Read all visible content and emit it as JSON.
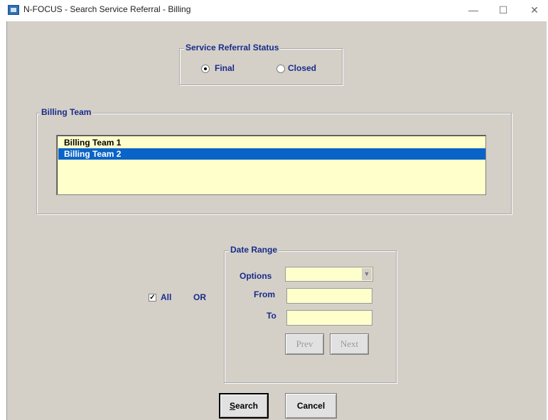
{
  "window": {
    "title": "N-FOCUS - Search Service Referral - Billing",
    "minimize": "—",
    "maximize": "☐",
    "close": "✕"
  },
  "status_group": {
    "legend": "Service Referral Status",
    "options": [
      {
        "label": "Final",
        "selected": true
      },
      {
        "label": "Closed",
        "selected": false
      }
    ]
  },
  "billing_group": {
    "legend": "Billing Team",
    "items": [
      "Billing Team 1",
      "Billing Team 2"
    ],
    "selected_index": 1
  },
  "all_checkbox": {
    "label": "All",
    "checked": true
  },
  "or_label": "OR",
  "date_group": {
    "legend": "Date Range",
    "options_label": "Options",
    "options_value": "",
    "from_label": "From",
    "from_value": "",
    "to_label": "To",
    "to_value": "",
    "prev_label": "Prev",
    "next_label": "Next"
  },
  "buttons": {
    "search_mnemonic": "S",
    "search_rest": "earch",
    "cancel": "Cancel"
  },
  "colors": {
    "label_text": "#1a2b8a",
    "field_bg": "#ffffcc",
    "selection": "#0a64c8",
    "window_bg": "#d4d0c8"
  }
}
